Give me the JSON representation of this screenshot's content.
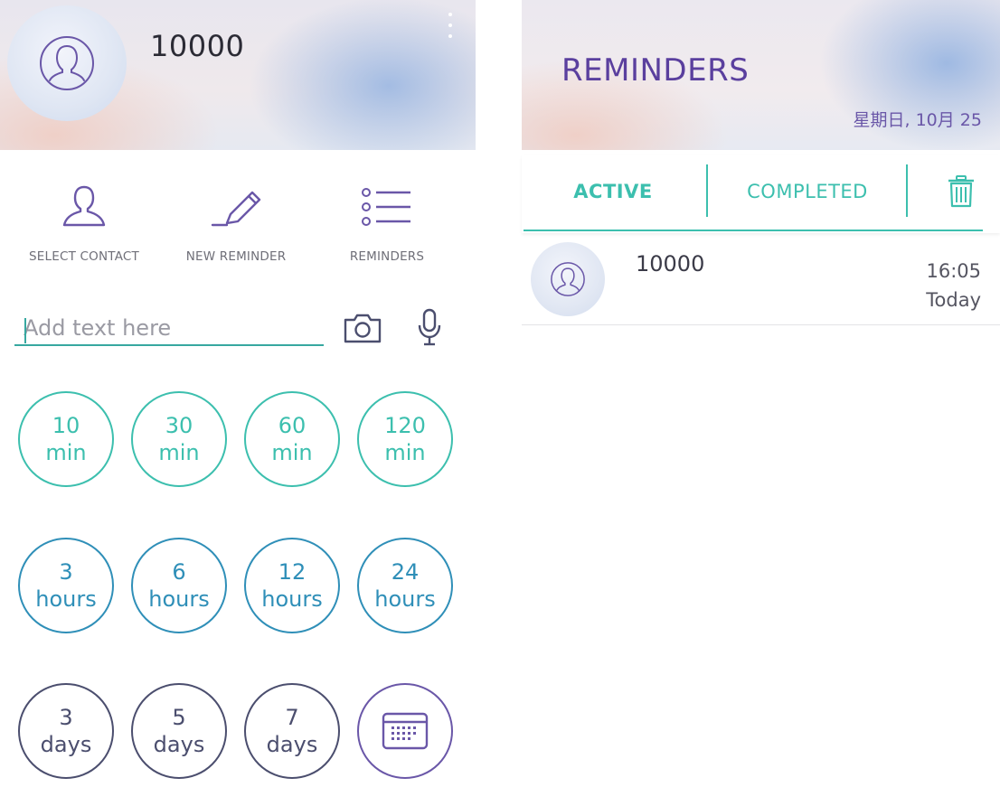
{
  "left": {
    "header": {
      "contact_name": "10000"
    },
    "actions": [
      {
        "label": "SELECT CONTACT",
        "icon": "person-icon"
      },
      {
        "label": "NEW REMINDER",
        "icon": "pencil-icon"
      },
      {
        "label": "REMINDERS",
        "icon": "list-icon"
      }
    ],
    "text_input": {
      "placeholder": "Add text here",
      "value": ""
    },
    "presets": {
      "minutes": [
        {
          "num": "10",
          "unit": "min"
        },
        {
          "num": "30",
          "unit": "min"
        },
        {
          "num": "60",
          "unit": "min"
        },
        {
          "num": "120",
          "unit": "min"
        }
      ],
      "hours": [
        {
          "num": "3",
          "unit": "hours"
        },
        {
          "num": "6",
          "unit": "hours"
        },
        {
          "num": "12",
          "unit": "hours"
        },
        {
          "num": "24",
          "unit": "hours"
        }
      ],
      "days": [
        {
          "num": "3",
          "unit": "days"
        },
        {
          "num": "5",
          "unit": "days"
        },
        {
          "num": "7",
          "unit": "days"
        }
      ],
      "calendar_icon": "calendar-icon"
    }
  },
  "right": {
    "header": {
      "title": "REMINDERS",
      "date": "星期日, 10月 25"
    },
    "tabs": {
      "active_label": "ACTIVE",
      "completed_label": "COMPLETED",
      "trash_icon": "trash-icon"
    },
    "reminders": [
      {
        "name": "10000",
        "time": "16:05",
        "day": "Today"
      }
    ]
  },
  "colors": {
    "teal": "#3cbfae",
    "blue": "#2f8fb8",
    "dark": "#4b4e6e",
    "purple": "#6a57a8",
    "title_purple": "#5a3f9e"
  }
}
